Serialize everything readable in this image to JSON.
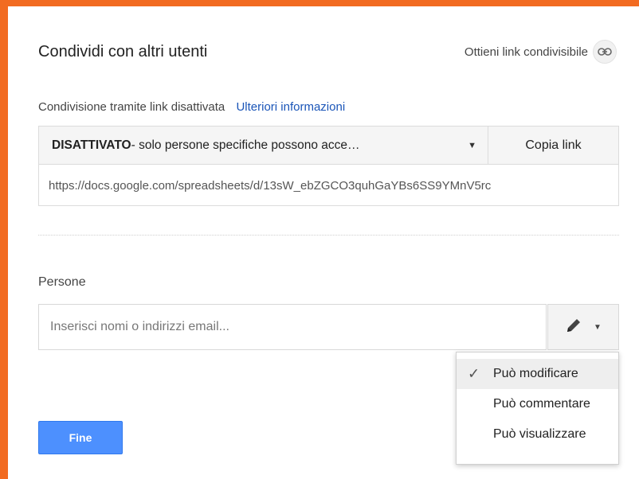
{
  "dialog": {
    "title": "Condividi con altri utenti",
    "get_link_label": "Ottieni link condivisibile",
    "link_status": "Condivisione tramite link disattivata",
    "more_info": "Ulteriori informazioni",
    "access": {
      "state": "DISATTIVATO",
      "description": " - solo persone specifiche possono acce…"
    },
    "copy_link_label": "Copia link",
    "share_url": "https://docs.google.com/spreadsheets/d/13sW_ebZGCO3quhGaYBs6SS9YMnV5rc",
    "people_label": "Persone",
    "people_input_placeholder": "Inserisci nomi o indirizzi email...",
    "permission_menu": {
      "items": [
        {
          "label": "Può modificare",
          "selected": true
        },
        {
          "label": "Può commentare",
          "selected": false
        },
        {
          "label": "Può visualizzare",
          "selected": false
        }
      ]
    },
    "done_label": "Fine"
  },
  "icons": {
    "link": "link-icon",
    "dropdown": "caret-down-icon",
    "permission": "pencil-icon",
    "selected": "checkmark-icon"
  },
  "colors": {
    "border_frame": "#f26b21",
    "primary_button": "#4d90fe",
    "link_text": "#1a55b8"
  }
}
